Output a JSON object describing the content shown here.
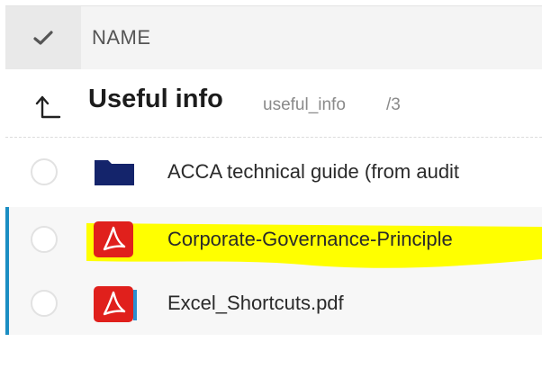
{
  "header": {
    "name_label": "NAME"
  },
  "folder": {
    "title": "Useful info",
    "slug": "useful_info",
    "count": "/3"
  },
  "files": [
    {
      "name": "ACCA technical guide (from audit",
      "type": "folder"
    },
    {
      "name": "Corporate-Governance-Principle",
      "type": "pdf",
      "highlighted": true,
      "highlight_color": "#ffff00"
    },
    {
      "name": "Excel_Shortcuts.pdf",
      "type": "pdf"
    }
  ],
  "colors": {
    "accent": "#1b8ec3",
    "folder_icon": "#14246b",
    "pdf_icon": "#e0201c",
    "highlight": "#ffff00"
  },
  "icons": {
    "check": "check-icon",
    "up": "level-up-icon",
    "folder": "folder-icon",
    "pdf": "pdf-file-icon"
  }
}
